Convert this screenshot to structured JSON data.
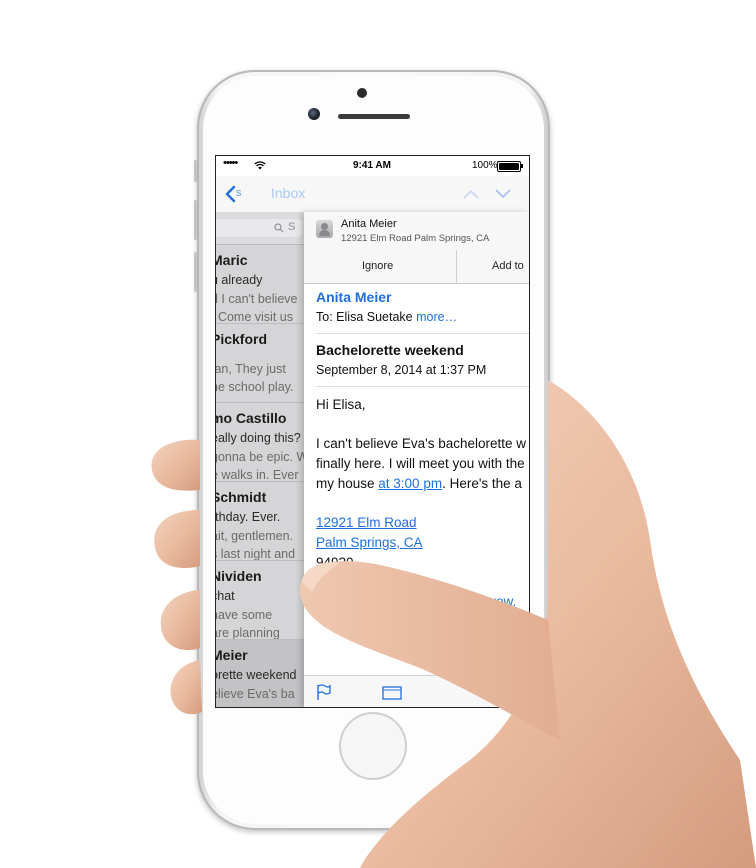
{
  "status_bar": {
    "signal": "•••••",
    "time": "9:41 AM",
    "battery": "100%"
  },
  "navbar": {
    "back_icon": "chevron-left-icon",
    "title": "Inbox"
  },
  "inbox": {
    "search_placeholder": "S",
    "rows": [
      {
        "name": "Maric",
        "subject": "u already",
        "preview_1": "d I can't believe",
        "preview_2": ". Come visit us",
        "selected": false
      },
      {
        "name": "Pickford",
        "subject": "",
        "preview_1": "fan, They just",
        "preview_2": "he school play.",
        "selected": false
      },
      {
        "name": "mo Castillo",
        "subject": "eally doing this?",
        "preview_1": "gonna be epic. W",
        "preview_2": "e walks in. Ever",
        "selected": false
      },
      {
        "name": "Schmidt",
        "subject": "rthday. Ever.",
        "preview_1": "ait, gentlemen.",
        "preview_2": "s last night and",
        "selected": false
      },
      {
        "name": "Nividen",
        "subject": "chat",
        "preview_1": "have some",
        "preview_2": "are planning",
        "selected": false
      },
      {
        "name": "Meier",
        "subject": "orette weekend",
        "preview_1": "elieve Eva's ba",
        "preview_2": "",
        "selected": true
      }
    ]
  },
  "message": {
    "contact_banner": {
      "name": "Anita Meier",
      "address": "12921 Elm Road Palm Springs, CA"
    },
    "actions": {
      "ignore": "Ignore",
      "add": "Add to"
    },
    "from": "Anita Meier",
    "to_label": "To:",
    "to_name": "Elisa Suetake",
    "more": "more…",
    "subject": "Bachelorette weekend",
    "date": "September 8, 2014 at 1:37 PM",
    "body": {
      "greeting": "Hi Elisa,",
      "line1": "I can't believe Eva's bachelorette w",
      "line2": "finally here. I will meet you with the",
      "line3_pre": "my house ",
      "line3_link": "at 3:00 pm",
      "line3_post": ". Here's the a",
      "address_1": "12921 Elm Road",
      "address_2": "Palm Springs, CA",
      "zip": "94920",
      "tomorrow_link": "tomorrow."
    },
    "toolbar": {
      "flag_icon": "flag-icon",
      "folder_icon": "folder-icon"
    }
  },
  "colors": {
    "accent": "#1f6fe0",
    "nav_title": "#a8c8f0",
    "selected_row": "#c3c3c6"
  }
}
